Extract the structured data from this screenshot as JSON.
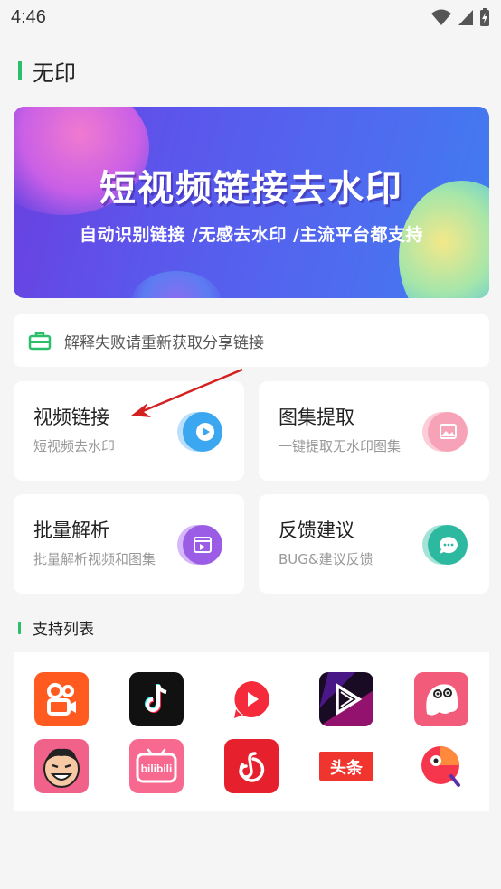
{
  "status_bar": {
    "time": "4:46"
  },
  "header": {
    "title": "无印"
  },
  "banner": {
    "title": "短视频链接去水印",
    "subtitle": "自动识别链接 /无感去水印 /主流平台都支持"
  },
  "notice": {
    "text": "解释失败请重新获取分享链接"
  },
  "cards": [
    {
      "title": "视频链接",
      "desc": "短视频去水印",
      "icon": "play-icon",
      "color": "#3aa7f0"
    },
    {
      "title": "图集提取",
      "desc": "一键提取无水印图集",
      "icon": "image-icon",
      "color": "#f47a95"
    },
    {
      "title": "批量解析",
      "desc": "批量解析视频和图集",
      "icon": "video-list-icon",
      "color": "#9b5de5"
    },
    {
      "title": "反馈建议",
      "desc": "BUG&建议反馈",
      "icon": "chat-icon",
      "color": "#2db8a0"
    }
  ],
  "support_section": {
    "title": "支持列表"
  },
  "platforms": [
    "kuaishou-icon",
    "douyin-icon",
    "weishi-icon",
    "haokan-icon",
    "pipixia-icon",
    "zuiyou-icon",
    "bilibili-icon",
    "netease-music-icon",
    "toutiao-icon",
    "xigua-icon"
  ],
  "platform_labels": {
    "bilibili": "bilibili",
    "toutiao": "头条"
  },
  "colors": {
    "accent": "#2bbf6b",
    "background": "#f5f5f5"
  }
}
